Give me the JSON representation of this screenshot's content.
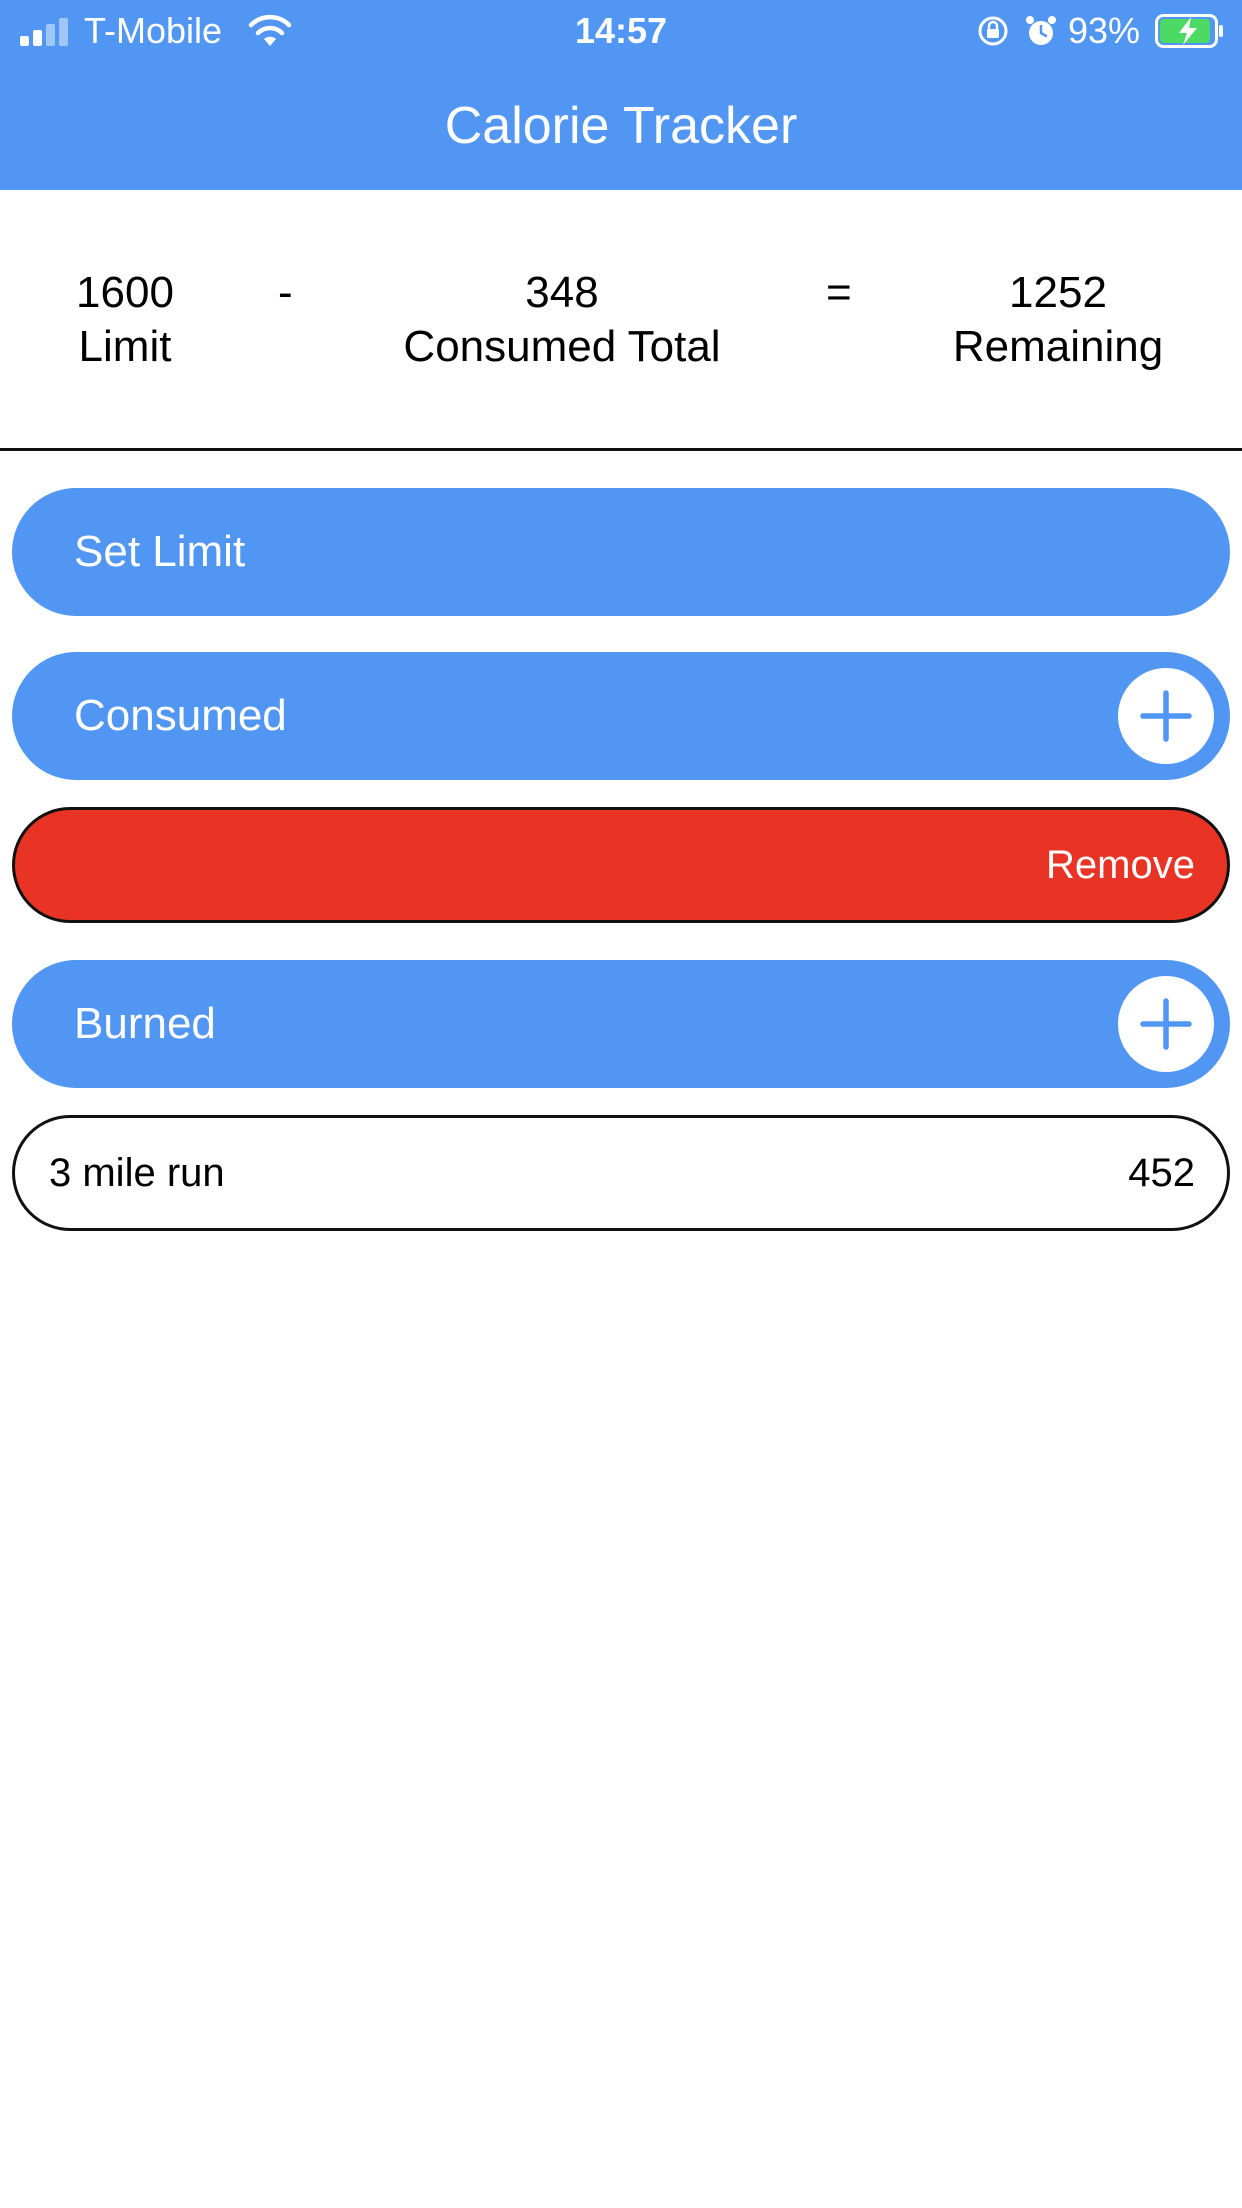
{
  "status_bar": {
    "carrier": "T-Mobile",
    "time": "14:57",
    "battery_percent": "93%"
  },
  "header": {
    "title": "Calorie Tracker"
  },
  "summary": {
    "limit_value": "1600",
    "limit_label": "Limit",
    "minus": "-",
    "consumed_value": "348",
    "consumed_label": "Consumed Total",
    "equals": "=",
    "remaining_value": "1252",
    "remaining_label": "Remaining"
  },
  "sections": {
    "set_limit_label": "Set Limit",
    "consumed_label": "Consumed",
    "remove_label": "Remove",
    "burned_label": "Burned"
  },
  "burned_entries": [
    {
      "name": "3 mile run",
      "calories": "452"
    }
  ],
  "colors": {
    "accent": "#5296f3",
    "danger": "#e93324",
    "battery_charging": "#4cd964"
  }
}
